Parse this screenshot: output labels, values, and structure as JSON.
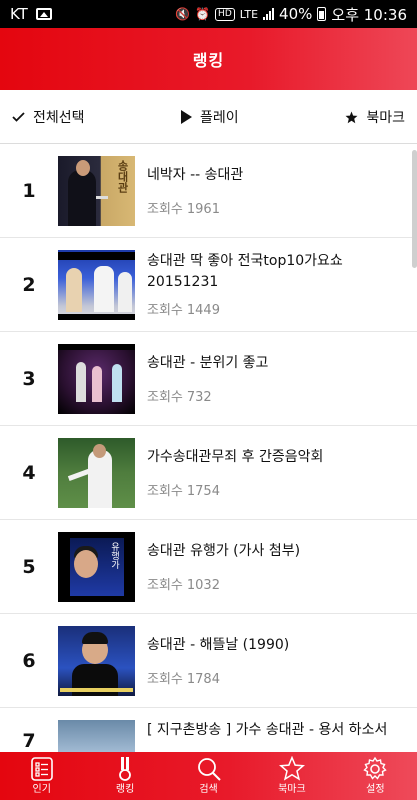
{
  "status_bar": {
    "carrier": "KT",
    "hd": "HD",
    "network": "LTE",
    "battery": "40%",
    "time": "오후 10:36"
  },
  "header": {
    "title": "랭킹"
  },
  "toolbar": {
    "select_all": "전체선택",
    "play": "플레이",
    "bookmark": "북마크"
  },
  "views_label": "조회수",
  "items": [
    {
      "rank": "1",
      "title": "네박자 -- 송대관",
      "views": "1961"
    },
    {
      "rank": "2",
      "title": "송대관 딱 좋아 전국top10가요쇼 20151231",
      "views": "1449"
    },
    {
      "rank": "3",
      "title": "송대관 - 분위기 좋고",
      "views": "732"
    },
    {
      "rank": "4",
      "title": "가수송대관무죄 후 간증음악회",
      "views": "1754"
    },
    {
      "rank": "5",
      "title": "송대관 유행가 (가사 첨부)",
      "views": "1032"
    },
    {
      "rank": "6",
      "title": "송대관 - 해뜰날 (1990)",
      "views": "1784"
    },
    {
      "rank": "7",
      "title": "[ 지구촌방송 ] 가수 송대관 - 용서 하소서"
    }
  ],
  "bottom_nav": {
    "popular": "인기",
    "ranking": "랭킹",
    "search": "검색",
    "bookmark": "북마크",
    "settings": "설정"
  },
  "colors": {
    "accent": "#e50914",
    "text": "#111111",
    "muted": "#8a8a8a"
  }
}
